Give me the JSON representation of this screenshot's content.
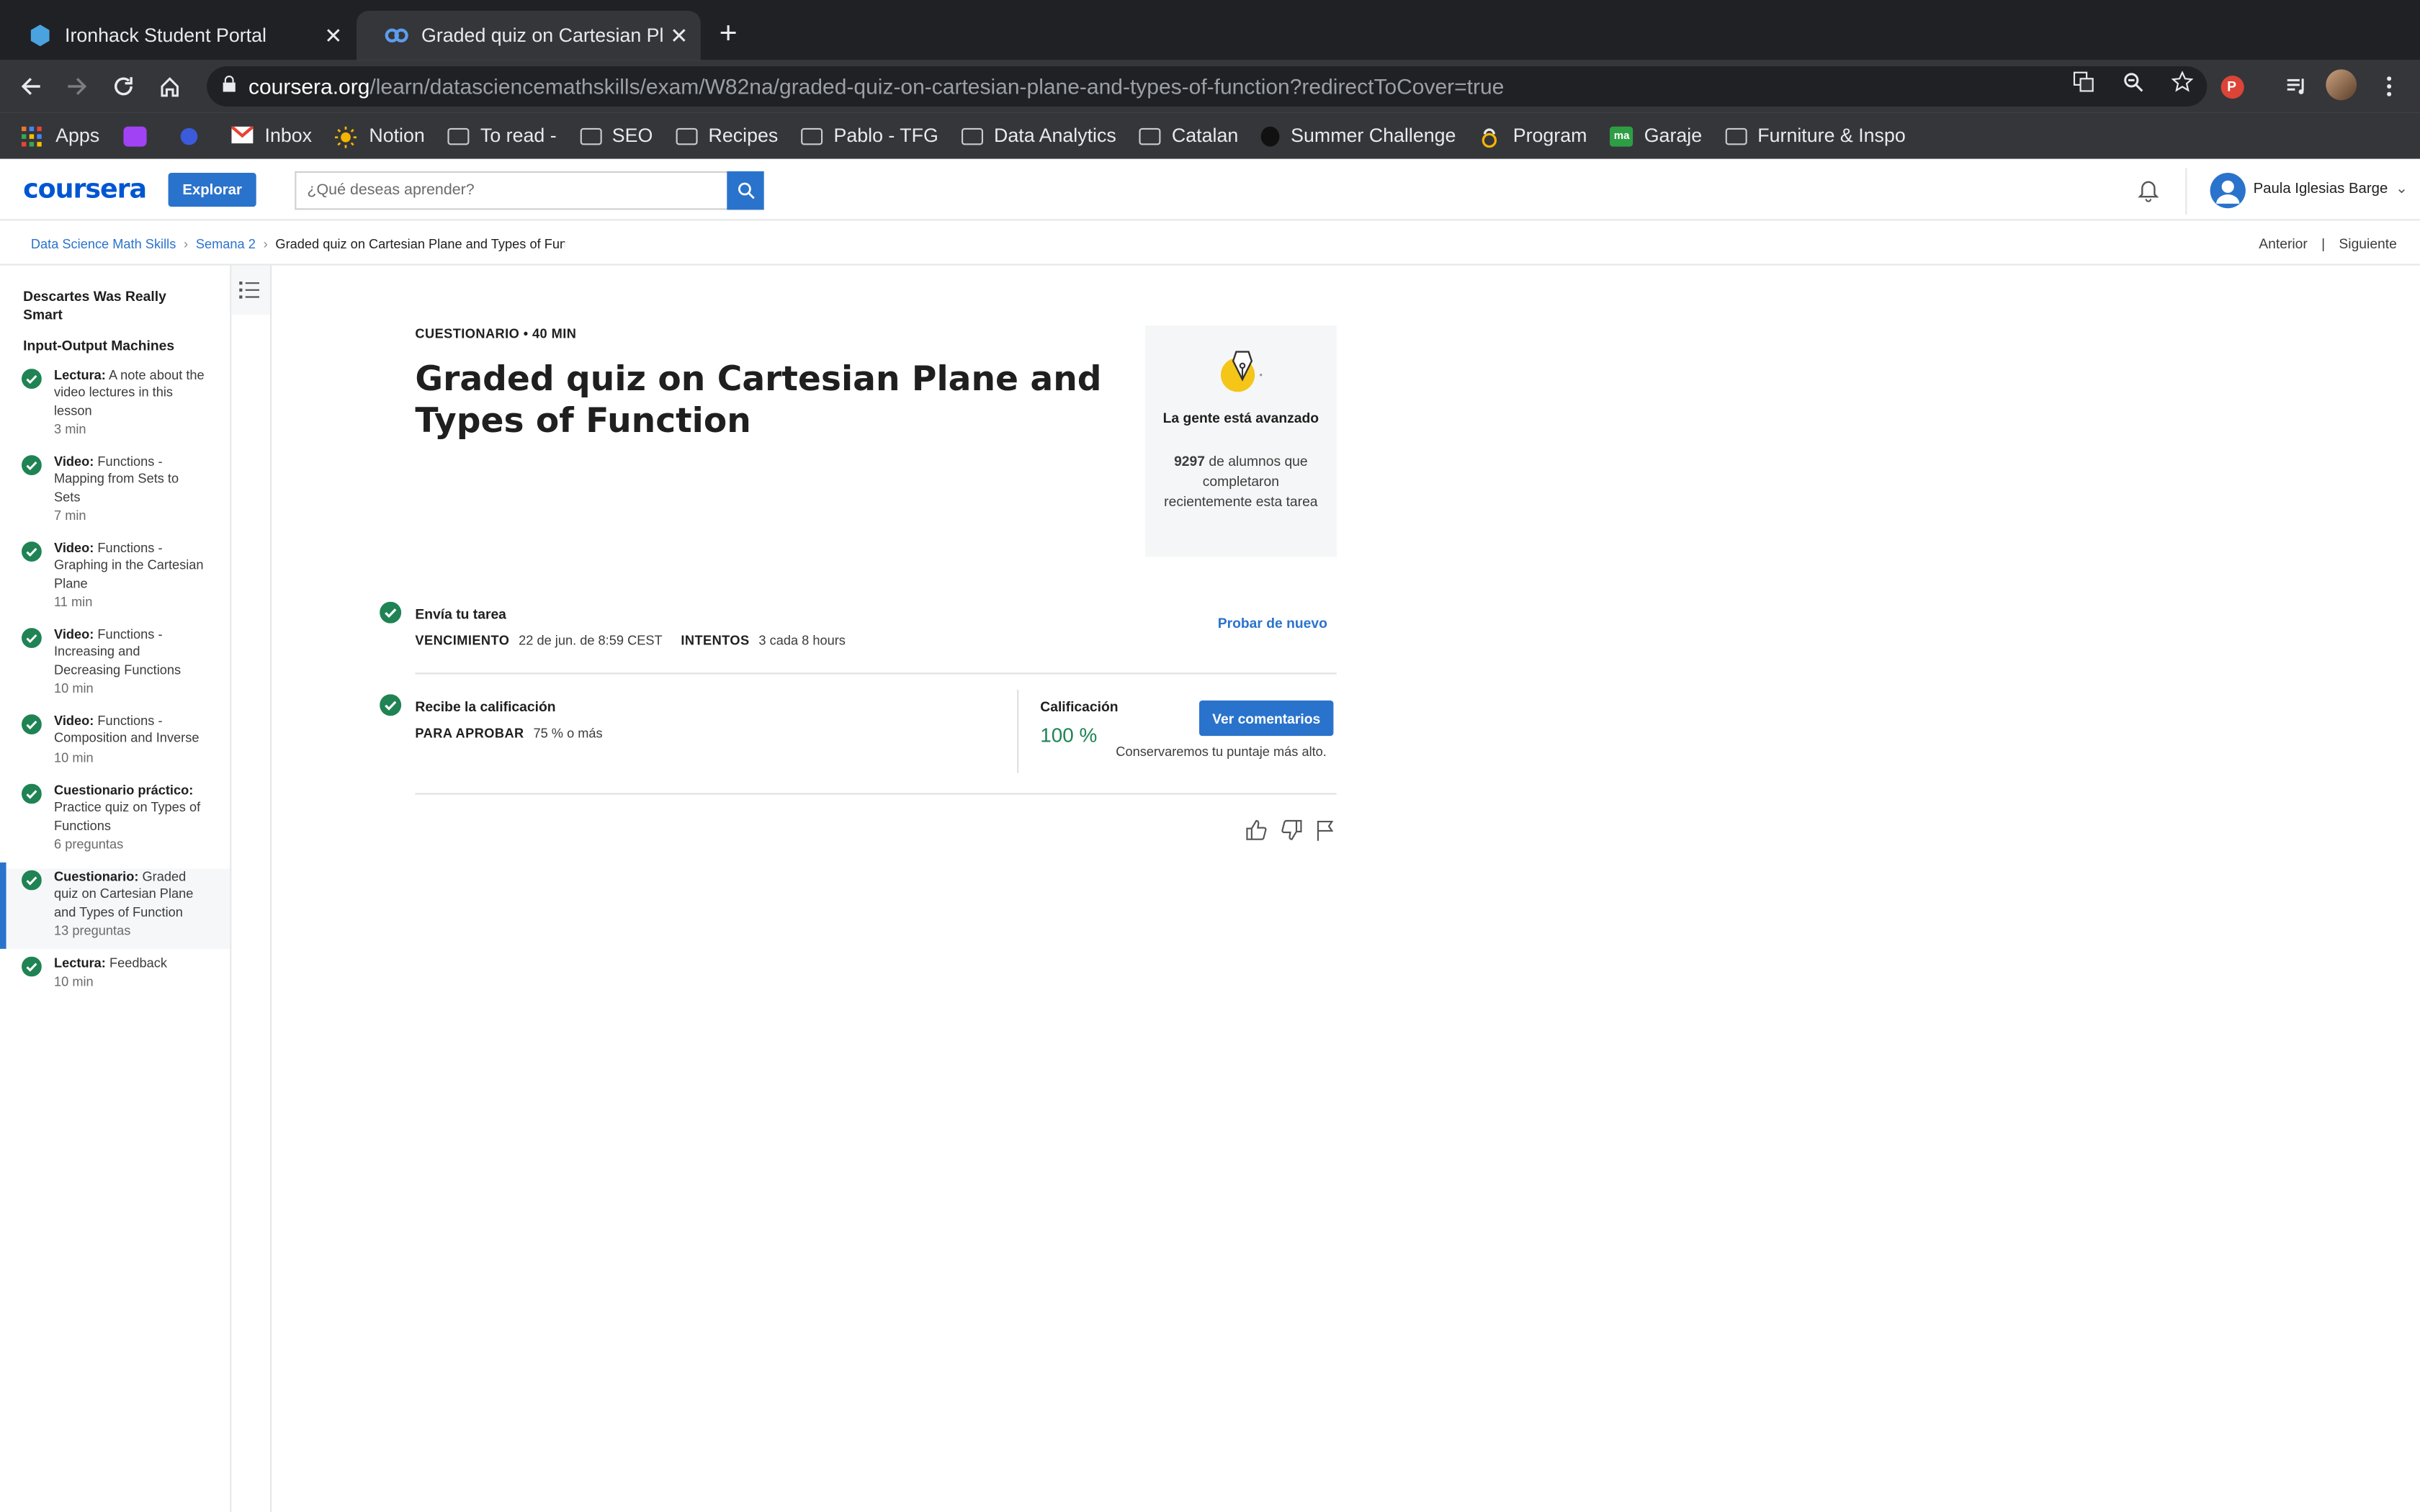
{
  "browser": {
    "tabs": [
      {
        "title": "Ironhack Student Portal",
        "active": false
      },
      {
        "title": "Graded quiz on Cartesian Plane and Types of Function",
        "active": true
      }
    ],
    "url_domain": "coursera.org",
    "url_path": "/learn/datasciencemathskills/exam/W82na/graded-quiz-on-cartesian-plane-and-types-of-function?redirectToCover=true",
    "profile_initial": "P",
    "bookmarks": [
      "Apps",
      "Inbox",
      "Notion",
      "To read -",
      "SEO",
      "Recipes",
      "Pablo - TFG",
      "Data Analytics",
      "Catalan",
      "Summer Challenge",
      "Program",
      "Garaje",
      "Furniture & Inspo"
    ]
  },
  "header": {
    "logo": "coursera",
    "explore_label": "Explorar",
    "search_placeholder": "¿Qué deseas aprender?",
    "user_name": "Paula Iglesias Barge"
  },
  "breadcrumb": {
    "items": [
      "Data Science Math Skills",
      "Semana 2"
    ],
    "current": "Graded quiz on Cartesian Plane and Types of Function",
    "prev_label": "Anterior",
    "next_label": "Siguiente"
  },
  "sidebar": {
    "section1": "Descartes Was Really Smart",
    "section2": "Input-Output Machines",
    "items": [
      {
        "type": "Lectura:",
        "name": "A note about the video lectures in this lesson",
        "meta": "3 min"
      },
      {
        "type": "Video:",
        "name": "Functions - Mapping from Sets to Sets",
        "meta": "7 min"
      },
      {
        "type": "Video:",
        "name": "Functions - Graphing in the Cartesian Plane",
        "meta": "11 min"
      },
      {
        "type": "Video:",
        "name": "Functions - Increasing and Decreasing Functions",
        "meta": "10 min"
      },
      {
        "type": "Video:",
        "name": "Functions - Composition and Inverse",
        "meta": "10 min"
      },
      {
        "type": "Cuestionario práctico:",
        "name": "Practice quiz on Types of Functions",
        "meta": "6 preguntas"
      },
      {
        "type": "Cuestionario:",
        "name": "Graded quiz on Cartesian Plane and Types of Function",
        "meta": "13 preguntas"
      },
      {
        "type": "Lectura:",
        "name": "Feedback",
        "meta": "10 min"
      }
    ]
  },
  "main": {
    "kicker": "CUESTIONARIO • 40 MIN",
    "title": "Graded quiz on Cartesian Plane and Types of Function",
    "card": {
      "heading": "La gente está avanzado",
      "count": "9297",
      "text": "de alumnos que completaron recientemente esta tarea"
    },
    "submit": {
      "title": "Envía tu tarea",
      "due_label": "VENCIMIENTO",
      "due_value": "22 de jun. de 8:59 CEST",
      "attempts_label": "INTENTOS",
      "attempts_value": "3 cada 8 hours",
      "retry_label": "Probar de nuevo"
    },
    "grade": {
      "title": "Recibe la calificación",
      "pass_label": "PARA APROBAR",
      "pass_value": "75 % o más",
      "grade_label": "Calificación",
      "grade_value": "100 %",
      "button_label": "Ver comentarios",
      "note": "Conservaremos tu puntaje más alto."
    }
  },
  "colors": {
    "accent": "#2a73cc",
    "success": "#1f8354",
    "chrome_dark": "#202124"
  }
}
